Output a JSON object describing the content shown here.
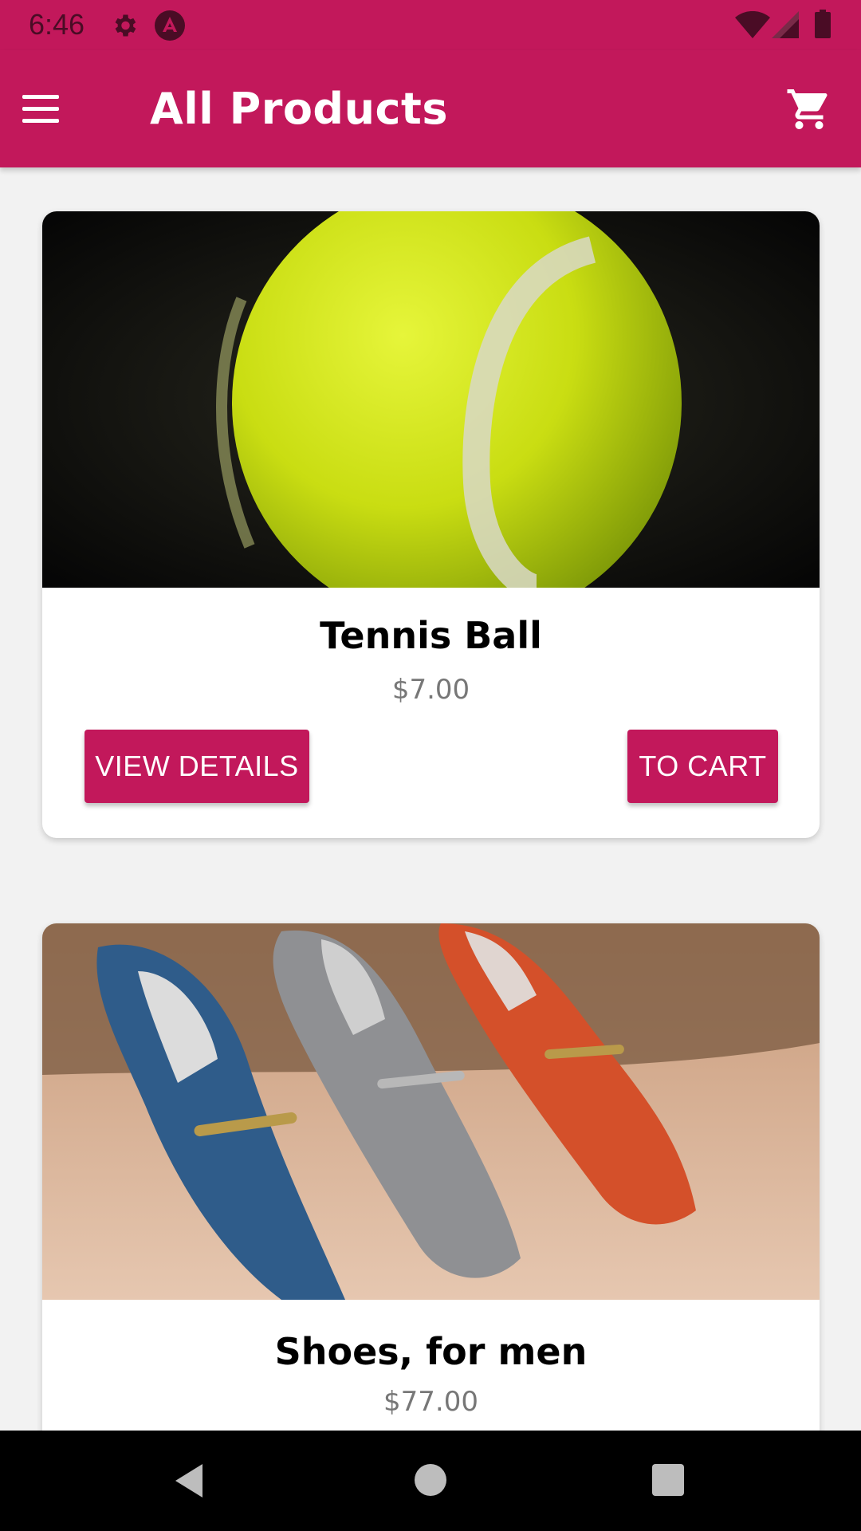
{
  "colors": {
    "primary": "#c2185b",
    "price": "#777777"
  },
  "status_bar": {
    "time": "6:46",
    "icons": [
      "gear-icon",
      "app-notification-icon",
      "wifi-icon",
      "cell-signal-icon",
      "battery-icon"
    ]
  },
  "app_bar": {
    "title": "All Products",
    "menu_icon": "hamburger-menu-icon",
    "cart_icon": "shopping-cart-icon"
  },
  "products": [
    {
      "name": "Tennis Ball",
      "price": "$7.00",
      "image": "tennis-ball-photo",
      "view_details_label": "VIEW DETAILS",
      "to_cart_label": "TO CART"
    },
    {
      "name": "Shoes, for men",
      "price": "$77.00",
      "image": "mens-loafers-photo"
    }
  ],
  "nav_bar": {
    "icons": [
      "back-icon",
      "home-icon",
      "recents-icon"
    ]
  }
}
